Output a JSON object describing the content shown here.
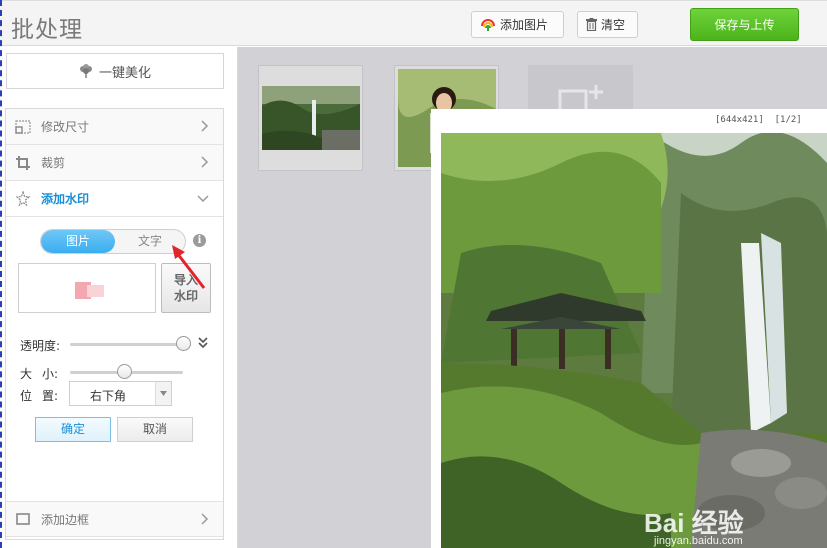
{
  "app": {
    "title": "批处理"
  },
  "toolbar": {
    "add_image_label": "添加图片",
    "clear_label": "清空",
    "save_upload_label": "保存与上传"
  },
  "sidebar": {
    "beautify_label": "一键美化",
    "items": [
      {
        "label": "修改尺寸",
        "icon": "resize-icon"
      },
      {
        "label": "裁剪",
        "icon": "crop-icon"
      },
      {
        "label": "添加水印",
        "icon": "watermark-icon",
        "active": true
      },
      {
        "label": "添加边框",
        "icon": "border-icon"
      }
    ],
    "watermark": {
      "mode_image": "图片",
      "mode_text": "文字",
      "selected_mode": "图片",
      "import_label_line1": "导入",
      "import_label_line2": "水印",
      "opacity_label": "透明度:",
      "opacity_value": 0.97,
      "size_label_a": "大",
      "size_label_b": "小:",
      "size_value": 0.48,
      "position_label_a": "位",
      "position_label_b": "置:",
      "position_value": "右下角",
      "ok_label": "确定",
      "cancel_label": "取消"
    }
  },
  "preview": {
    "meta": "[644x421]  [1/2]",
    "watermark_text": "Bai 经验",
    "watermark_url": "jingyan.baidu.com"
  },
  "colors": {
    "accent_blue": "#1a8fd6",
    "save_green": "#4cb31b",
    "workspace_gray": "#d2d2d6",
    "arrow_red": "#e0262b"
  }
}
